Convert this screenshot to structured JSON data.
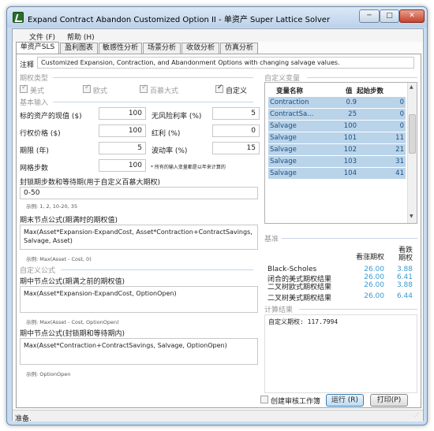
{
  "window": {
    "title": "Expand Contract Abandon Customized Option II - 单资产 Super Lattice Solver",
    "minimize": "─",
    "maximize": "□",
    "close": "✕"
  },
  "menu": {
    "file": "文件 (F)",
    "help": "帮助 (H)"
  },
  "tabs": [
    "单资产SLS",
    "盈利图表",
    "敏感性分析",
    "场景分析",
    "收敛分析",
    "仿真分析"
  ],
  "notes": {
    "label": "注释",
    "value": "Customized Expansion, Contraction, and Abandonment Options with changing salvage values."
  },
  "option_type": {
    "header": "期权类型",
    "american": "美式",
    "european": "欧式",
    "bermudan": "百慕大式",
    "custom": "自定义"
  },
  "basic_input": {
    "header": "基本输入",
    "pv_label": "标的资产的现值 ($)",
    "pv_value": "100",
    "strike_label": "行权价格 ($)",
    "strike_value": "100",
    "maturity_label": "期限 (年)",
    "maturity_value": "5",
    "steps_label": "网格步数",
    "steps_value": "100",
    "rf_label": "无风险利率 (%)",
    "rf_value": "5",
    "div_label": "红利 (%)",
    "div_value": "0",
    "vol_label": "波动率 (%)",
    "vol_value": "15",
    "note": "* 所有的输入变量都是以年来计算的"
  },
  "blackout": {
    "label": "封锁期步数和等待期(用于自定义百慕大期权)",
    "value": "0-50",
    "example": "示例: 1, 2, 10-20, 35"
  },
  "terminal": {
    "label": "期末节点公式(期满时的期权值)",
    "value": "Max(Asset*Expansion-ExpandCost, Asset*Contraction+ContractSavings, Salvage, Asset)",
    "example": "示例: Max(Asset - Cost, 0)"
  },
  "custom_formula": {
    "header": "自定义公式"
  },
  "intermediate": {
    "label": "期中节点公式(期满之前的期权值)",
    "value": "Max(Asset*Expansion-ExpandCost, OptionOpen)",
    "example": "示例: Max(Asset - Cost, OptionOpen)"
  },
  "intermediate_blackout": {
    "label": "期中节点公式(封锁期和等待期内)",
    "value": "Max(Asset*Contraction+ContractSavings, Salvage, OptionOpen)",
    "example": "示例: OptionOpen"
  },
  "custom_vars": {
    "header": "自定义变量",
    "col_name": "变量名称",
    "col_value": "值",
    "col_step": "起始步数",
    "rows": [
      {
        "name": "Contraction",
        "value": "0.9",
        "step": "0"
      },
      {
        "name": "ContractSa...",
        "value": "25",
        "step": "0"
      },
      {
        "name": "Salvage",
        "value": "100",
        "step": "0"
      },
      {
        "name": "Salvage",
        "value": "101",
        "step": "11"
      },
      {
        "name": "Salvage",
        "value": "102",
        "step": "21"
      },
      {
        "name": "Salvage",
        "value": "103",
        "step": "31"
      },
      {
        "name": "Salvage",
        "value": "104",
        "step": "41"
      }
    ]
  },
  "benchmark": {
    "header": "基准",
    "col_call": "看涨期权",
    "col_put": "看跌\n期权",
    "rows": [
      {
        "name": "Black-Scholes",
        "call": "26.00",
        "put": "3.88"
      },
      {
        "name": "闭合的美式期权结果",
        "call": "26.00",
        "put": "6.41"
      },
      {
        "name": "二叉树欧式期权结果",
        "call": "26.00",
        "put": "3.88"
      },
      {
        "name": "二叉树美式期权结果",
        "call": "26.00",
        "put": "6.44"
      }
    ]
  },
  "results": {
    "header": "计算结果",
    "text": "自定义期权: 117.7994"
  },
  "audit": {
    "label": "创建审核工作簿"
  },
  "buttons": {
    "run": "运行 (R)",
    "print": "打印(P)"
  },
  "status": {
    "text": "准备."
  },
  "colors": {
    "accent": "#3b98cf",
    "grid_row": "#b9d3e9",
    "title_bar": "#c9dcee"
  }
}
